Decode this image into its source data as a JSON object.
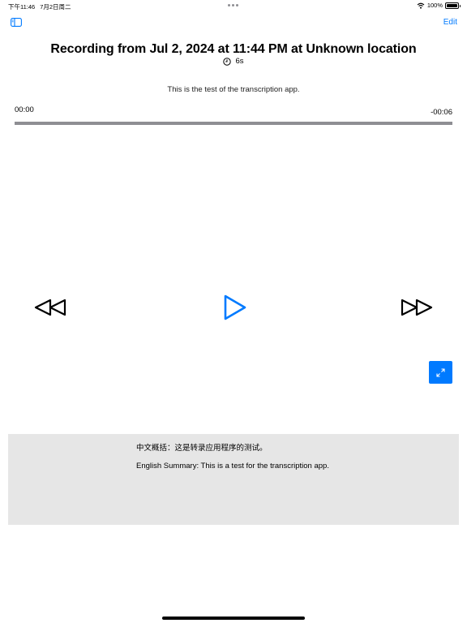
{
  "status_bar": {
    "time": "下午11:46",
    "date": "7月2日周二",
    "battery": "100%"
  },
  "nav": {
    "edit_label": "Edit"
  },
  "recording": {
    "title": "Recording from Jul 2, 2024 at 11:44 PM at Unknown location",
    "duration": "6s",
    "transcript": "This is the test of the transcription app."
  },
  "player": {
    "current_time": "00:00",
    "remaining_time": "-00:06",
    "progress": 0
  },
  "summary": {
    "chinese": "中文概括：这是转录应用程序的测试。",
    "english": "English Summary: This is a test for the transcription app."
  },
  "colors": {
    "accent": "#007aff",
    "track": "#8e8e93",
    "panel": "#e6e6e6"
  },
  "icons": [
    "wifi-icon",
    "battery-icon",
    "sidebar-toggle-icon",
    "clock-icon",
    "rewind-icon",
    "play-icon",
    "fast-forward-icon",
    "expand-icon"
  ]
}
